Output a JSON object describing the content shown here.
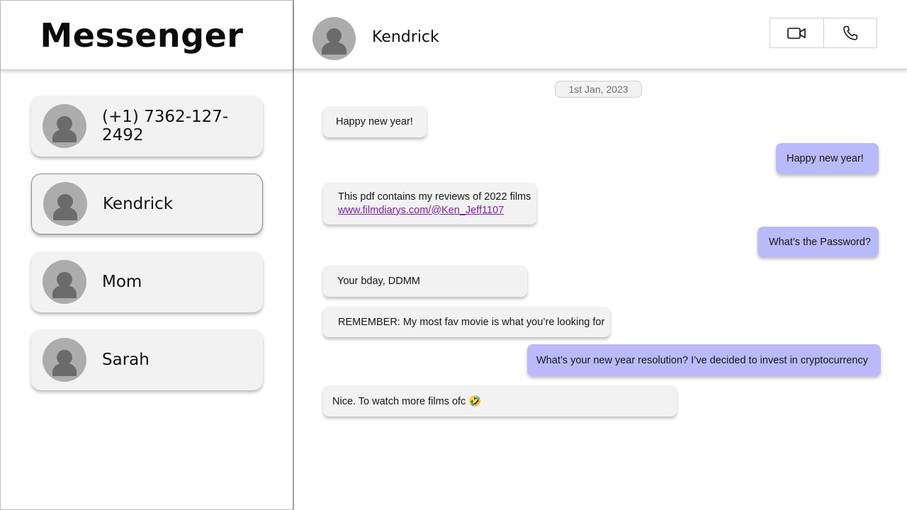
{
  "app": {
    "title": "Messenger"
  },
  "contacts": [
    {
      "name": "(+1) 7362-127-2492",
      "active": false
    },
    {
      "name": "Kendrick",
      "active": true
    },
    {
      "name": "Mom",
      "active": false
    },
    {
      "name": "Sarah",
      "active": false
    }
  ],
  "chat": {
    "contact_name": "Kendrick",
    "icons": {
      "video": "video-camera-icon",
      "call": "phone-icon"
    },
    "date_label": "1st Jan, 2023",
    "messages": [
      {
        "direction": "incoming",
        "text": "Happy new year!"
      },
      {
        "direction": "outgoing",
        "text": "Happy new year!"
      },
      {
        "direction": "incoming",
        "text": "This pdf contains my reviews of 2022 films",
        "link": "www.filmdiarys.com/@Ken_Jeff1107"
      },
      {
        "direction": "outgoing",
        "text": "What’s the Password?"
      },
      {
        "direction": "incoming",
        "text": "Your bday, DDMM"
      },
      {
        "direction": "incoming",
        "text": "REMEMBER: My most fav movie is what you’re looking for"
      },
      {
        "direction": "outgoing",
        "text": "What’s your new year resolution? I’ve decided to invest in cryptocurrency"
      },
      {
        "direction": "incoming",
        "text": "Nice. To watch more films ofc 🤣"
      }
    ]
  },
  "colors": {
    "incoming_bubble": "#f2f2f2",
    "outgoing_bubble": "#b9baf9",
    "avatar": "#acacac",
    "link": "#7a1fa2"
  }
}
